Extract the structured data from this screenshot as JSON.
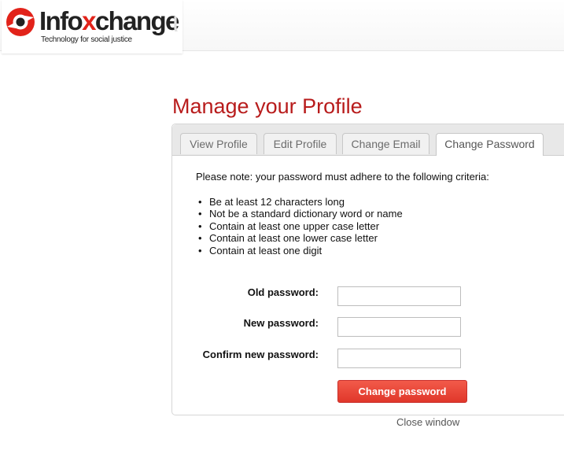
{
  "brand": {
    "name_prefix": "Info",
    "name_x": "x",
    "name_suffix": "change",
    "tagline": "Technology for social justice",
    "accent_color": "#e2231a",
    "icon": "infoxchange-logo-icon"
  },
  "page": {
    "title": "Manage your Profile",
    "title_color": "#b81c1c"
  },
  "tabs": [
    {
      "label": "View Profile",
      "active": false
    },
    {
      "label": "Edit Profile",
      "active": false
    },
    {
      "label": "Change Email",
      "active": false
    },
    {
      "label": "Change Password",
      "active": true
    }
  ],
  "form": {
    "note": "Please note: your password must adhere to the following criteria:",
    "criteria": [
      "Be at least 12 characters long",
      "Not be a standard dictionary word or name",
      "Contain at least one upper case letter",
      "Contain at least one lower case letter",
      "Contain at least one digit"
    ],
    "fields": {
      "old": {
        "label": "Old password:",
        "value": ""
      },
      "new": {
        "label": "New password:",
        "value": ""
      },
      "confirm": {
        "label": "Confirm new password:",
        "value": ""
      }
    },
    "submit_label": "Change password",
    "submit_color": "#e8392e"
  },
  "footer": {
    "close_label": "Close window"
  }
}
